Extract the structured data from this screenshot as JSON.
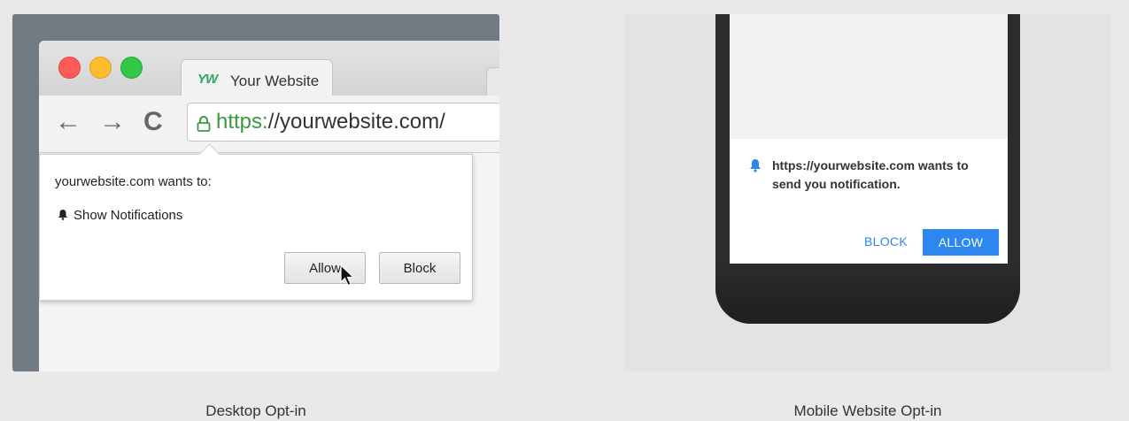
{
  "desktop": {
    "tab_logo": "YW",
    "tab_title": "Your Website",
    "nav_back": "←",
    "nav_forward": "→",
    "nav_reload": "C",
    "url_scheme": "https:",
    "url_rest": "//yourwebsite.com/",
    "popup_heading": "yourwebsite.com wants to:",
    "permission_label": "Show Notifications",
    "allow_label": "Allow",
    "block_label": "Block",
    "caption": "Desktop Opt-in"
  },
  "mobile": {
    "message": "https://yourwebsite.com wants to send you notification.",
    "block_label": "BLOCK",
    "allow_label": "ALLOW",
    "caption": "Mobile Website Opt-in"
  },
  "colors": {
    "mobile_accent": "#2e86f0",
    "url_secure": "#3b9a3b",
    "logo": "#2ea66a"
  }
}
